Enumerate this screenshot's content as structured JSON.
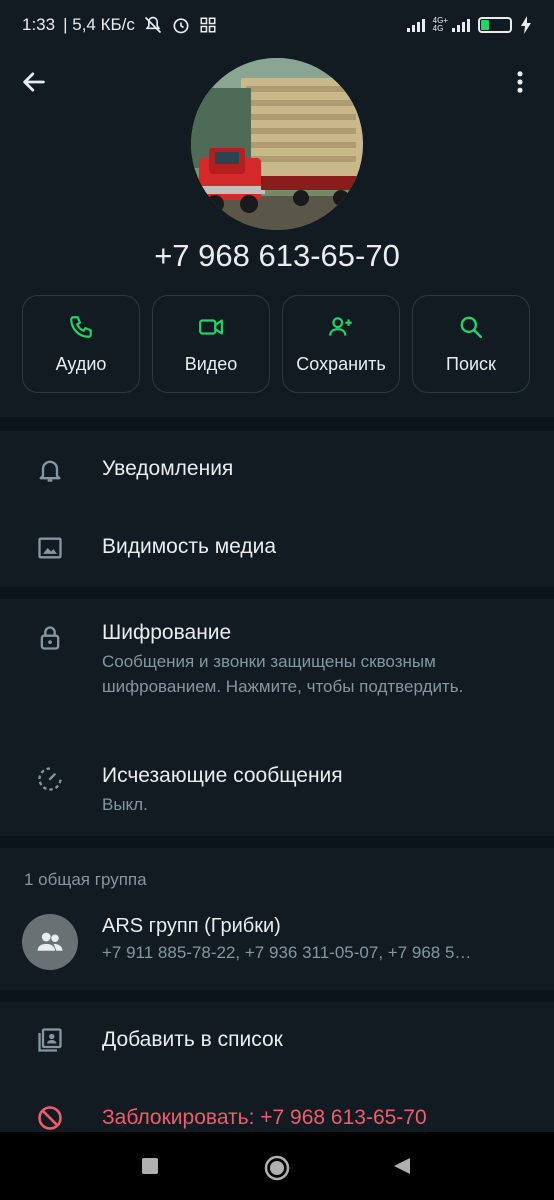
{
  "status_bar": {
    "time": "1:33",
    "speed": "| 5,4 КБ/с",
    "net_top": "4G+",
    "net_bottom": "4G",
    "battery_level": "12"
  },
  "header": {
    "phone_number": "+7 968 613-65-70",
    "actions": [
      {
        "label": "Аудио",
        "icon": "phone-icon"
      },
      {
        "label": "Видео",
        "icon": "video-icon"
      },
      {
        "label": "Сохранить",
        "icon": "add-contact-icon"
      },
      {
        "label": "Поиск",
        "icon": "search-icon"
      }
    ]
  },
  "settings": {
    "notifications": "Уведомления",
    "media_visibility": "Видимость медиа",
    "encryption_title": "Шифрование",
    "encryption_sub": "Сообщения и звонки защищены сквозным шифрованием. Нажмите, чтобы подтвердить.",
    "disappearing_title": "Исчезающие сообщения",
    "disappearing_sub": "Выкл."
  },
  "groups": {
    "header": "1 общая группа",
    "items": [
      {
        "name": "ARS групп (Грибки)",
        "members": "+7 911 885-78-22, +7 936 311-05-07, +7 968 5…"
      }
    ]
  },
  "footer_actions": {
    "add_to_list": "Добавить в список",
    "block": "Заблокировать: +7 968 613-65-70"
  },
  "colors": {
    "accent": "#25d366",
    "danger": "#f15c6d",
    "background": "#0b141a",
    "surface": "#111b21"
  }
}
